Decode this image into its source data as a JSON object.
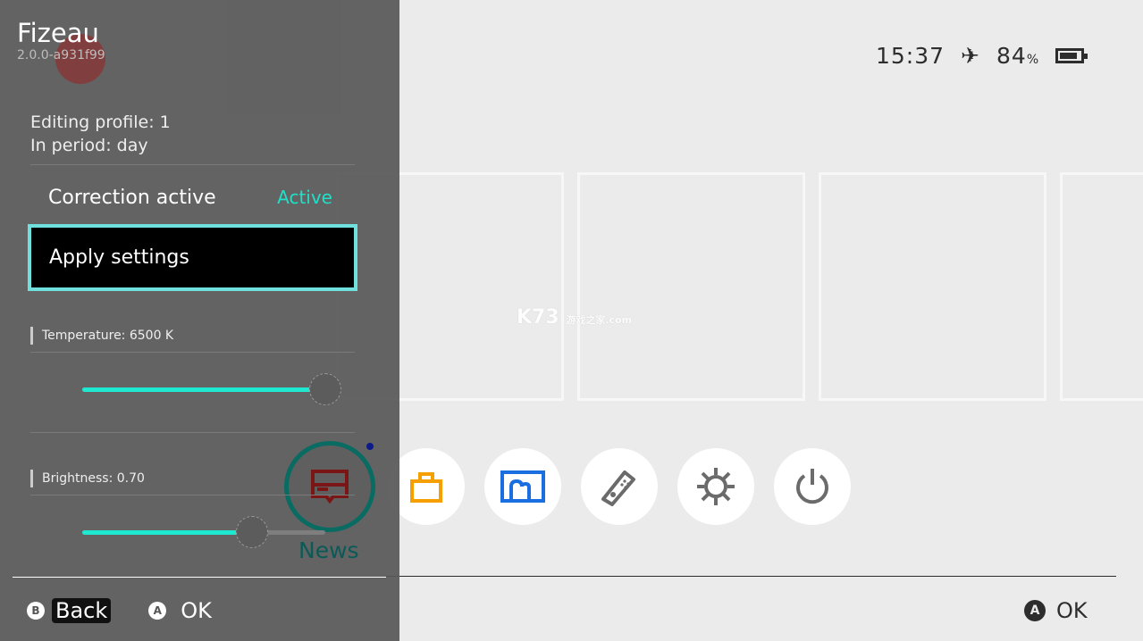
{
  "status": {
    "time": "15:37",
    "airplane_icon": "airplane-icon",
    "battery_percent": "84",
    "battery_unit": "%",
    "battery_level": 0.84
  },
  "home": {
    "dock": [
      {
        "name": "news",
        "label": "News",
        "color": "#8b1a1a"
      },
      {
        "name": "eshop",
        "color": "#f5a000"
      },
      {
        "name": "album",
        "color": "#1a6ee0"
      },
      {
        "name": "controllers",
        "color": "#6b6b6b"
      },
      {
        "name": "settings",
        "color": "#6b6b6b"
      },
      {
        "name": "power",
        "color": "#6b6b6b"
      }
    ],
    "ok_button": "A",
    "ok_label": "OK",
    "watermark": {
      "main": "K73",
      "cn": "游戏之家",
      "sub": ".com"
    }
  },
  "overlay": {
    "title": "Fizeau",
    "version": "2.0.0-a931f99",
    "editing_profile": "Editing profile: 1",
    "period": "In period: day",
    "correction_label": "Correction active",
    "correction_value": "Active",
    "apply_label": "Apply settings",
    "temperature_label": "Temperature: 6500 K",
    "temperature_fraction": 1.0,
    "brightness_label": "Brightness: 0.70",
    "brightness_value": 0.7,
    "footer": {
      "back_key": "B",
      "back_label": "Back",
      "ok_key": "A",
      "ok_label": "OK"
    },
    "accent": "#1fe8d0"
  }
}
